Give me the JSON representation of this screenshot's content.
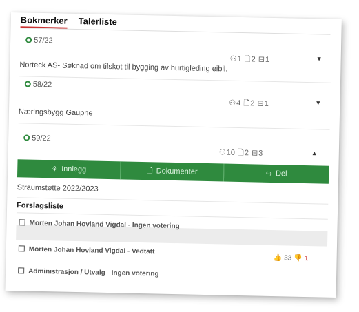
{
  "tabs": [
    {
      "label": "Bokmerker",
      "active": true
    },
    {
      "label": "Talerliste",
      "active": false
    }
  ],
  "cases": [
    {
      "number": "57/22",
      "title": "Norteck AS- Søknad om tilskot til bygging av hurtigleding eibil.",
      "people": "1",
      "docs": "2",
      "items": "1",
      "expanded": false
    },
    {
      "number": "58/22",
      "title": "Næringsbygg Gaupne",
      "people": "4",
      "docs": "2",
      "items": "1",
      "expanded": false
    },
    {
      "number": "59/22",
      "title": "Straumstøtte 2022/2023",
      "people": "10",
      "docs": "2",
      "items": "3",
      "expanded": true
    }
  ],
  "actions": {
    "innlegg": "Innlegg",
    "dokumenter": "Dokumenter",
    "del": "Del"
  },
  "proposals": {
    "section_title": "Forslagsliste",
    "items": [
      {
        "author": "Morten Johan Hovland Vigdal",
        "status": "Ingen votering"
      },
      {
        "author": "Morten Johan Hovland Vigdal",
        "status": "Vedtatt",
        "votes_for": "33",
        "votes_against": "1"
      },
      {
        "author": "Administrasjon / Utvalg",
        "status": "Ingen votering"
      }
    ]
  },
  "colors": {
    "accent_green": "#2f8a3e",
    "tab_underline": "#cc3333"
  },
  "icons": {
    "people": "people-icon",
    "docs": "document-icon",
    "items": "list-box-icon"
  }
}
